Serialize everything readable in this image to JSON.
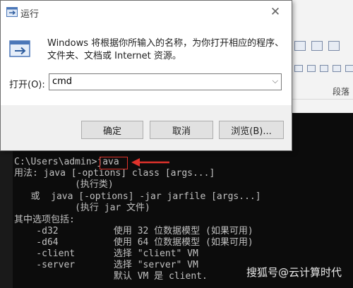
{
  "dialog": {
    "title": "运行",
    "description": "Windows 将根据你所输入的名称，为你打开相应的程序、文件夹、文档或 Internet 资源。",
    "open_label": "打开(O):",
    "open_value": "cmd",
    "buttons": {
      "ok": "确定",
      "cancel": "取消",
      "browse": "浏览(B)..."
    }
  },
  "ribbon": {
    "group_label": "段落"
  },
  "console": {
    "lines": [
      "C:\\Users\\admin>java",
      "用法: java [-options] class [args...]",
      "           (执行类)",
      "   或  java [-options] -jar jarfile [args...]",
      "           (执行 jar 文件)",
      "其中选项包括:",
      "    -d32          使用 32 位数据模型 (如果可用)",
      "    -d64          使用 64 位数据模型 (如果可用)",
      "    -client       选择 \"client\" VM",
      "    -server       选择 \"server\" VM",
      "                  默认 VM 是 client."
    ]
  },
  "watermark": "搜狐号@云计算时代",
  "colors": {
    "highlight": "#e0322b",
    "console_bg": "#0c0c0c",
    "console_fg": "#c0c0c0"
  }
}
